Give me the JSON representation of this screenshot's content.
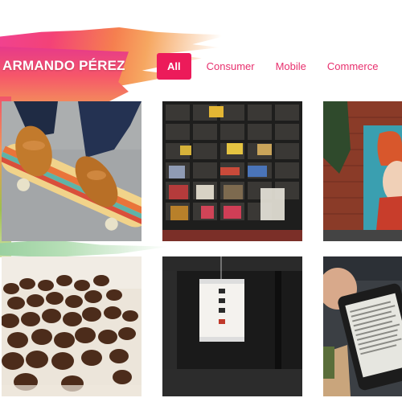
{
  "header": {
    "logo_text": "ARMANDO PÉREZ"
  },
  "nav": {
    "tabs": [
      {
        "label": "All",
        "active": true
      },
      {
        "label": "Consumer",
        "active": false
      },
      {
        "label": "Mobile",
        "active": false
      },
      {
        "label": "Commerce",
        "active": false
      }
    ]
  },
  "gallery": {
    "items": [
      {
        "subject": "skateboard"
      },
      {
        "subject": "bookshelf"
      },
      {
        "subject": "mural"
      },
      {
        "subject": "coffee-beans"
      },
      {
        "subject": "paper-lantern"
      },
      {
        "subject": "e-reader"
      }
    ]
  },
  "lantern_text": "",
  "colors": {
    "accent": "#ec1b5a",
    "tab_text": "#e8306e",
    "background": "#ffffff"
  }
}
